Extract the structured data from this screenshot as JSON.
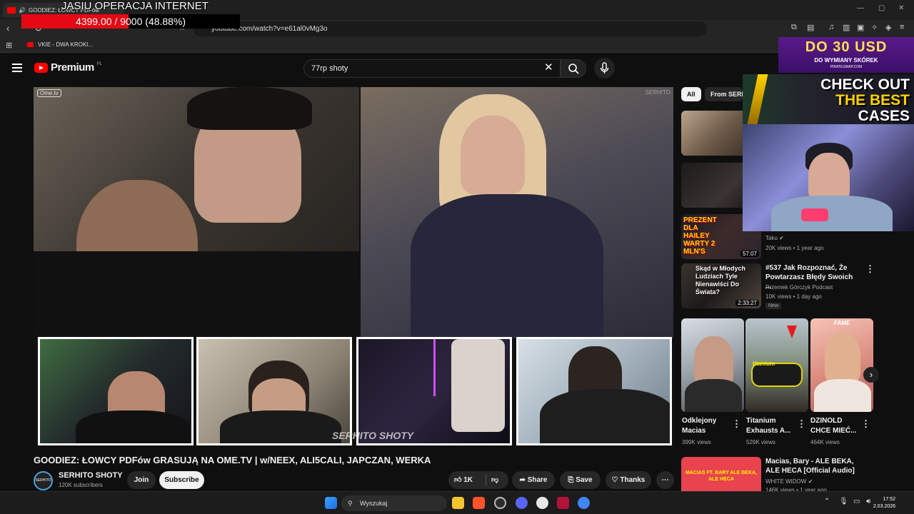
{
  "browser": {
    "tab_title": "GOODIEZ: ŁOWCY PDFów",
    "url": "youtube.com/watch?v=e61al0vMg3o",
    "bookmark": "VKIE - DWA KROKI..."
  },
  "overlay_goal": {
    "title": "JASIU OPERACJA INTERNET",
    "progress_text": "4399.00 / 9000 (48.88%)",
    "progress_fraction": 0.4888
  },
  "header": {
    "logo_text": "Premium",
    "logo_suffix": "PL",
    "search_value": "77rp shoty"
  },
  "video": {
    "ome_logo": "Ome.tv",
    "watermark": "SERHITO",
    "shoty_overlay": "SERHITO SHOTY",
    "title": "GOODIEZ: ŁOWCY PDFów GRASUJĄ NA OME.TV | w/NEEX, ALI5CALI, JAPCZAN, WERKA",
    "channel_name": "SERHITO SHOTY",
    "channel_avatar_text": "SERHITO",
    "subscribers": "120K subscribers",
    "join_label": "Join",
    "subscribe_label": "Subscribe",
    "likes": "1K",
    "share_label": "Share",
    "save_label": "Save",
    "thanks_label": "Thanks"
  },
  "chips": [
    "All",
    "From SERHITO"
  ],
  "recommended": [
    {
      "channel": "Taku",
      "meta": "20K views • 1 year ago",
      "duration": "57:07",
      "thumb_text": "PREZENT DLA HAILEY WARTY 2 MLN'S"
    },
    {
      "title": "#537 Jak Rozpoznać, Że Powtarzasz Błędy Swoich ...",
      "channel": "Przemek Górczyk Podcast",
      "meta": "10K views • 1 day ago",
      "badge": "New",
      "duration": "2:33:27",
      "thumb_text": "Skąd w Młodych Ludziach Tyle Nienawiści Do Świata?"
    },
    {
      "title": "Macias, Bary - ALE BEKA, ALE HECA [Official Audio]",
      "channel": "WHITE WIDOW",
      "meta": "146K views • 1 year ago",
      "thumb_text": "MACIAS FT. BARY ALE BEKA, ALE HECA"
    }
  ],
  "shorts": [
    {
      "title": "Odklejony Macias",
      "views": "399K views"
    },
    {
      "title": "Titanium Exhausts A...",
      "views": "529K views",
      "thumb_text": "titanium"
    },
    {
      "title": "DZINOLD CHCE MIEĆ...",
      "views": "464K views",
      "thumb_text": "FAME"
    }
  ],
  "ads": {
    "top_big": "DO 30 USD",
    "top_small": "DO WYMIANY SKÓREK",
    "top_site": "PIRATESWAP.COM",
    "cases_line1": "CHECK OUT",
    "cases_line2": "THE BEST",
    "cases_line3": "CASES"
  },
  "taskbar": {
    "search_placeholder": "Wyszukaj",
    "time": "17:52",
    "date": "2.03.2026"
  },
  "colors": {
    "yt_red": "#ff0000",
    "background": "#0f0f0f",
    "goal_fill": "#e50914",
    "ad_yellow": "#ffe14d"
  }
}
